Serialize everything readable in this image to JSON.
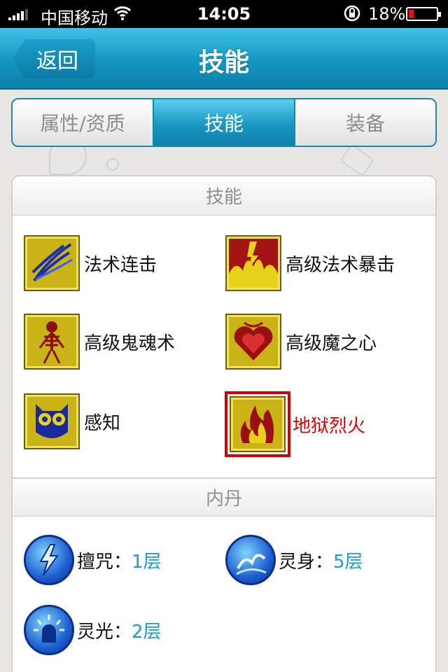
{
  "status_bar": {
    "carrier": "中国移动",
    "time": "14:05",
    "battery_percent": "18%",
    "battery_level": 0.18,
    "icons": [
      "signal-icon",
      "wifi-icon",
      "rotation-lock-icon",
      "battery-icon"
    ]
  },
  "nav": {
    "back_label": "返回",
    "title": "技能"
  },
  "tabs": [
    {
      "label": "属性/资质",
      "active": false
    },
    {
      "label": "技能",
      "active": true
    },
    {
      "label": "装备",
      "active": false
    }
  ],
  "skills_section": {
    "header": "技能",
    "items": [
      {
        "name": "法术连击",
        "icon": "lightning-claw-icon",
        "selected": false
      },
      {
        "name": "高级法术暴击",
        "icon": "fire-burst-icon",
        "selected": false
      },
      {
        "name": "高级鬼魂术",
        "icon": "skeleton-icon",
        "selected": false
      },
      {
        "name": "高级魔之心",
        "icon": "demon-heart-icon",
        "selected": false
      },
      {
        "name": "感知",
        "icon": "owl-icon",
        "selected": false
      },
      {
        "name": "地狱烈火",
        "icon": "hellfire-icon",
        "selected": true
      }
    ]
  },
  "neidan_section": {
    "header": "内丹",
    "items": [
      {
        "name": "擅咒：",
        "level": "1层",
        "icon": "lightning-orb-icon"
      },
      {
        "name": "灵身：",
        "level": "5层",
        "icon": "spirit-body-orb-icon"
      },
      {
        "name": "灵光：",
        "level": "2层",
        "icon": "spirit-light-orb-icon"
      }
    ]
  },
  "colors": {
    "accent": "#1a96c3",
    "selected_skill": "#e00000",
    "level_text": "#1a9ad0",
    "battery_low": "#e31010"
  }
}
